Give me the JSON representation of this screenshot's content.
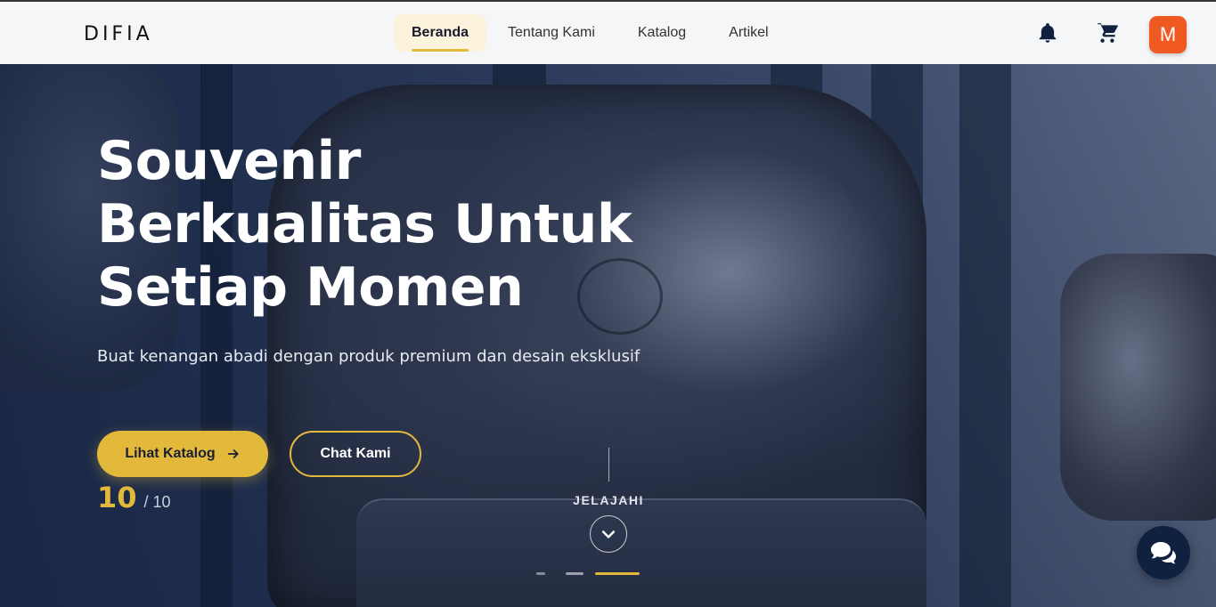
{
  "header": {
    "logo": "DIFIA",
    "nav": [
      {
        "label": "Beranda",
        "active": true
      },
      {
        "label": "Tentang Kami",
        "active": false
      },
      {
        "label": "Katalog",
        "active": false
      },
      {
        "label": "Artikel",
        "active": false
      }
    ],
    "icons": [
      "bell-icon",
      "cart-icon"
    ],
    "avatar_initial": "M",
    "avatar_color": "#f05a22"
  },
  "hero": {
    "title_lines": [
      "Souvenir",
      "Berkualitas Untuk",
      "Setiap Momen"
    ],
    "subtitle": "Buat kenangan abadi dengan produk premium dan desain eksklusif",
    "primary_button": "Lihat Katalog",
    "secondary_button": "Chat Kami",
    "slide_current": "10",
    "slide_total": "/ 10",
    "explore_label": "JELAJAHI",
    "slide_indicators": [
      {
        "active": false
      },
      {
        "active": false
      },
      {
        "active": true
      }
    ]
  },
  "colors": {
    "accent": "#e2b93b",
    "navy": "#10203f",
    "avatar": "#f05a22"
  },
  "chat_fab": {
    "icon": "chat-bubbles-icon"
  }
}
